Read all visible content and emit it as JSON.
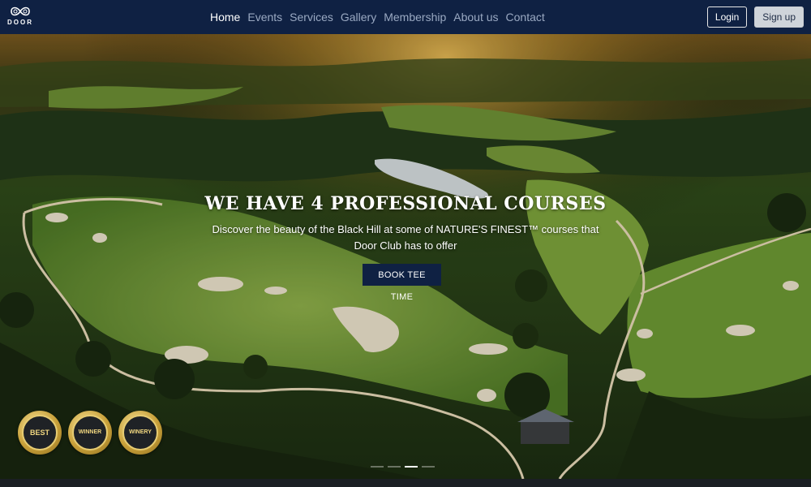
{
  "brand": {
    "logo_icon": "infinity-leaf-logo",
    "name": "DOOR"
  },
  "nav": {
    "items": [
      {
        "label": "Home",
        "active": true
      },
      {
        "label": "Events",
        "active": false
      },
      {
        "label": "Services",
        "active": false
      },
      {
        "label": "Gallery",
        "active": false
      },
      {
        "label": "Membership",
        "active": false
      },
      {
        "label": "About us",
        "active": false
      },
      {
        "label": "Contact",
        "active": false
      }
    ]
  },
  "auth": {
    "login_label": "Login",
    "signup_label": "Sign up"
  },
  "hero": {
    "title": "WE HAVE 4 PROFESSIONAL COURSES",
    "subtitle_line1": "Discover the beauty of the Black Hill at some of NATURE'S FINEST™ courses that",
    "subtitle_line2": "Door Club has to offer",
    "cta_label": "BOOK TEE TIME",
    "background": "aerial-golf-course-photo"
  },
  "badges": [
    {
      "icon": "best-award-badge",
      "text": "BEST"
    },
    {
      "icon": "winner-award-badge",
      "text": "WINNER"
    },
    {
      "icon": "winery-award-badge",
      "text": "WINERY"
    }
  ],
  "carousel": {
    "slide_count": 4,
    "active_index": 2
  },
  "colors": {
    "navy": "#0f2143",
    "nav_inactive": "#9aa9c2",
    "gold": "#c9a13a"
  }
}
